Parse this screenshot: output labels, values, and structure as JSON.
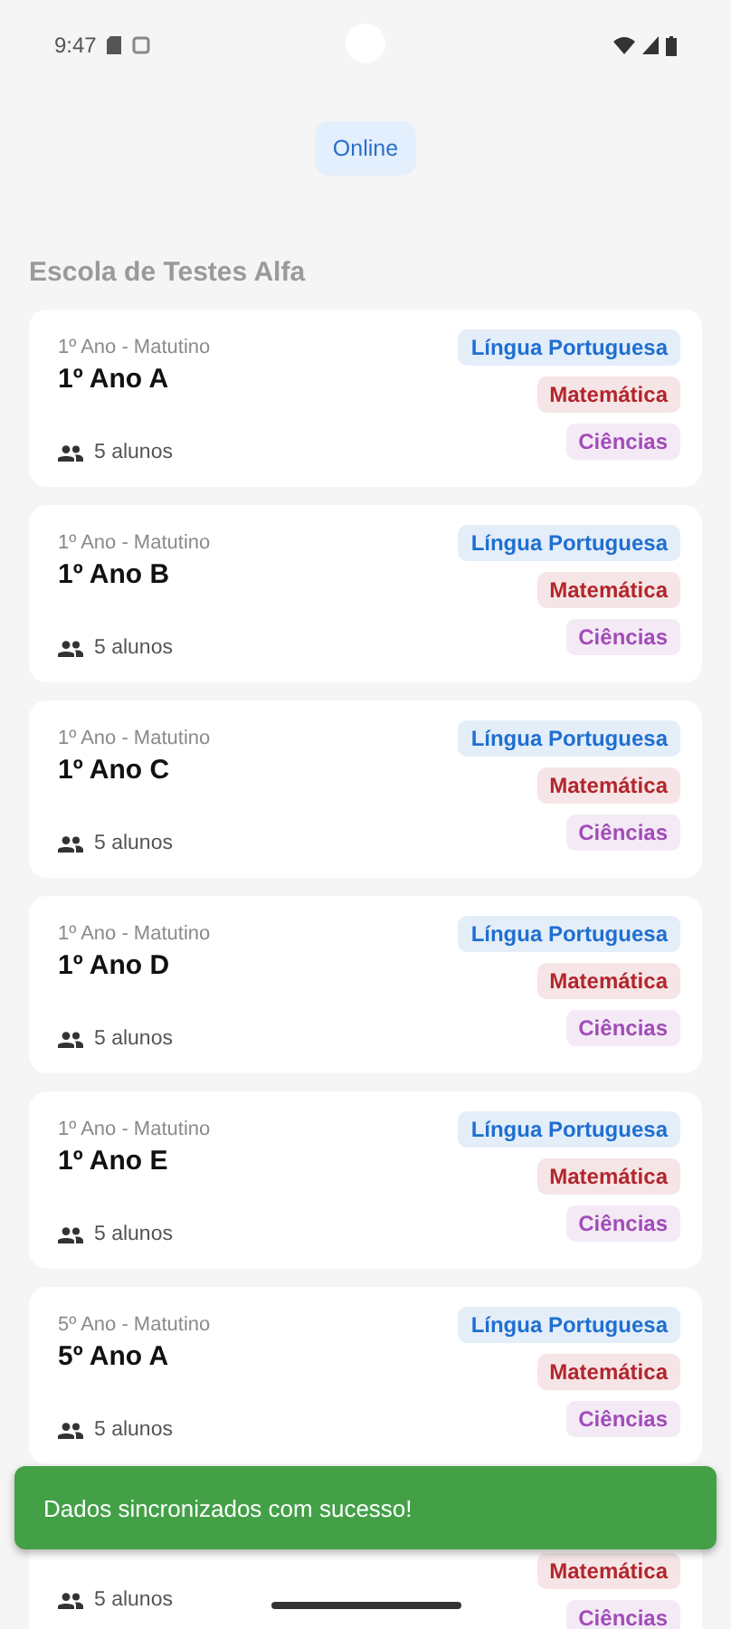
{
  "status_bar": {
    "time": "9:47"
  },
  "connection_chip": {
    "label": "Online"
  },
  "school": {
    "name": "Escola de Testes Alfa"
  },
  "classes": [
    {
      "kind": "full",
      "grade": "1º Ano - Matutino",
      "name": "1º Ano A",
      "students": "5 alunos",
      "subjects": [
        {
          "label": "Língua Portuguesa",
          "color": "#1f6fd1"
        },
        {
          "label": "Matemática",
          "color": "#b3262c"
        },
        {
          "label": "Ciências",
          "color": "#a24cb8"
        }
      ]
    },
    {
      "kind": "full",
      "grade": "1º Ano - Matutino",
      "name": "1º Ano B",
      "students": "5 alunos",
      "subjects": [
        {
          "label": "Língua Portuguesa",
          "color": "#1f6fd1"
        },
        {
          "label": "Matemática",
          "color": "#b3262c"
        },
        {
          "label": "Ciências",
          "color": "#a24cb8"
        }
      ]
    },
    {
      "kind": "full",
      "grade": "1º Ano - Matutino",
      "name": "1º Ano C",
      "students": "5 alunos",
      "subjects": [
        {
          "label": "Língua Portuguesa",
          "color": "#1f6fd1"
        },
        {
          "label": "Matemática",
          "color": "#b3262c"
        },
        {
          "label": "Ciências",
          "color": "#a24cb8"
        }
      ]
    },
    {
      "kind": "full",
      "grade": "1º Ano - Matutino",
      "name": "1º Ano D",
      "students": "5 alunos",
      "subjects": [
        {
          "label": "Língua Portuguesa",
          "color": "#1f6fd1"
        },
        {
          "label": "Matemática",
          "color": "#b3262c"
        },
        {
          "label": "Ciências",
          "color": "#a24cb8"
        }
      ]
    },
    {
      "kind": "full",
      "grade": "1º Ano - Matutino",
      "name": "1º Ano E",
      "students": "5 alunos",
      "subjects": [
        {
          "label": "Língua Portuguesa",
          "color": "#1f6fd1"
        },
        {
          "label": "Matemática",
          "color": "#b3262c"
        },
        {
          "label": "Ciências",
          "color": "#a24cb8"
        }
      ]
    },
    {
      "kind": "full",
      "grade": "5º Ano - Matutino",
      "name": "5º Ano A",
      "students": "5 alunos",
      "subjects": [
        {
          "label": "Língua Portuguesa",
          "color": "#1f6fd1"
        },
        {
          "label": "Matemática",
          "color": "#b3262c"
        },
        {
          "label": "Ciências",
          "color": "#a24cb8"
        }
      ]
    },
    {
      "kind": "covered",
      "students": "5 alunos",
      "subjects": [
        {
          "label": "Matemática",
          "color": "#b3262c"
        },
        {
          "label": "Ciências",
          "color": "#a24cb8"
        }
      ]
    }
  ],
  "snackbar": {
    "message": "Dados sincronizados com sucesso!"
  }
}
